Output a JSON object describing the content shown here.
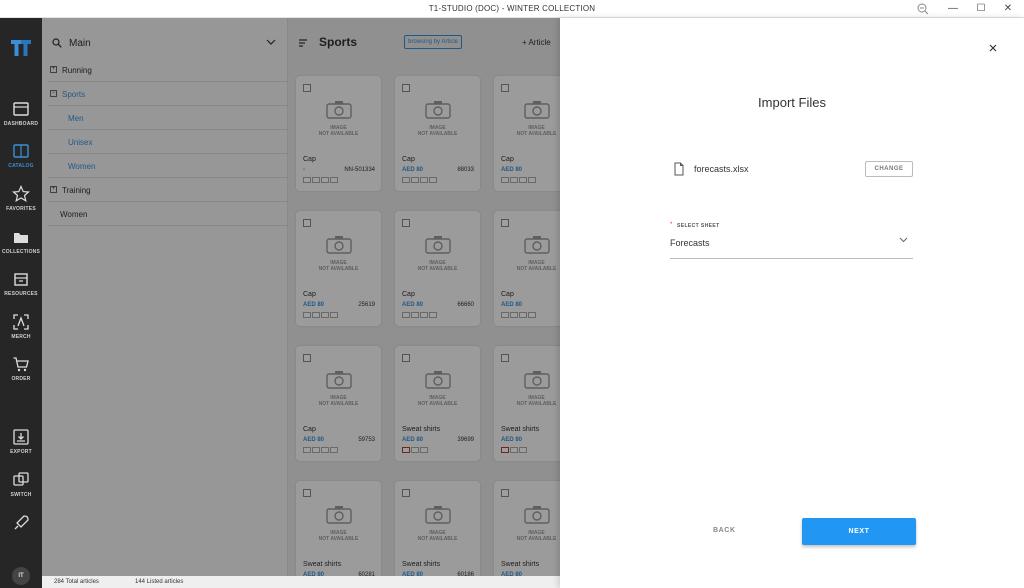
{
  "window": {
    "title": "T1-STUDIO (DOC) - WINTER COLLECTION",
    "zoom_icon": "zoom-out-icon",
    "minimize_glyph": "—",
    "maximize_glyph": "☐",
    "close_glyph": "✕"
  },
  "rail": {
    "items": [
      {
        "label": "DASHBOARD",
        "icon": "dashboard-icon"
      },
      {
        "label": "CATALOG",
        "icon": "catalog-icon",
        "active": true
      },
      {
        "label": "FAVORITES",
        "icon": "star-icon"
      },
      {
        "label": "COLLECTIONS",
        "icon": "folder-icon"
      },
      {
        "label": "RESOURCES",
        "icon": "resources-icon"
      },
      {
        "label": "MERCH",
        "icon": "merch-icon"
      },
      {
        "label": "ORDER",
        "icon": "cart-icon"
      },
      {
        "label": "EXPORT",
        "icon": "export-icon"
      },
      {
        "label": "SWITCH",
        "icon": "switch-icon"
      },
      {
        "label": "",
        "icon": "rocket-icon"
      }
    ],
    "avatar": "IT",
    "accent": "#3b8fd6"
  },
  "sidenav": {
    "title": "Main",
    "items": [
      {
        "label": "Running",
        "toggle": "+",
        "type": "parent"
      },
      {
        "label": "Sports",
        "toggle": "−",
        "type": "parent-open"
      },
      {
        "label": "Men",
        "type": "child"
      },
      {
        "label": "Unisex",
        "type": "child"
      },
      {
        "label": "Women",
        "type": "child"
      },
      {
        "label": "Training",
        "toggle": "+",
        "type": "parent"
      },
      {
        "label": "Women",
        "type": "plain"
      }
    ]
  },
  "content": {
    "heading": "Sports",
    "browse_badge": "browsing by Article",
    "add_label": "+ Article",
    "image_na_line1": "IMAGE",
    "image_na_line2": "NOT AVAILABLE",
    "cards": [
      {
        "name": "Cap",
        "price": "-",
        "code": "NN-501334",
        "sizes": [
          0,
          0,
          0,
          0
        ]
      },
      {
        "name": "Cap",
        "price": "AED 80",
        "code": "88033",
        "sizes": [
          0,
          0,
          0,
          0
        ]
      },
      {
        "name": "Cap",
        "price": "AED 80",
        "code": "16",
        "sizes": [
          0,
          0,
          0,
          0
        ]
      },
      {
        "name": "Cap",
        "price": "AED 80",
        "code": "25619",
        "sizes": [
          0,
          0,
          0,
          0
        ]
      },
      {
        "name": "Cap",
        "price": "AED 80",
        "code": "66660",
        "sizes": [
          0,
          0,
          0,
          0
        ]
      },
      {
        "name": "Cap",
        "price": "AED 80",
        "code": "43",
        "sizes": [
          0,
          0,
          0,
          0
        ]
      },
      {
        "name": "Cap",
        "price": "AED 80",
        "code": "59753",
        "sizes": [
          0,
          0,
          0,
          0
        ]
      },
      {
        "name": "Sweat shirts",
        "price": "AED 80",
        "code": "39699",
        "sizes": [
          1,
          0,
          0
        ]
      },
      {
        "name": "Sweat shirts",
        "price": "AED 80",
        "code": "95",
        "sizes": [
          1,
          0,
          0
        ]
      },
      {
        "name": "Sweat shirts",
        "price": "AED 80",
        "code": "60281",
        "sizes": [
          0,
          0,
          0
        ]
      },
      {
        "name": "Sweat shirts",
        "price": "AED 80",
        "code": "60186",
        "sizes": [
          0,
          0,
          0
        ]
      },
      {
        "name": "Sweat shirts",
        "price": "AED 80",
        "code": "51",
        "sizes": [
          0,
          0,
          0
        ]
      }
    ]
  },
  "statusbar": {
    "total": "284 Total articles",
    "listed": "144 Listed articles"
  },
  "dialog": {
    "title": "Import Files",
    "file_name": "forecasts.xlsx",
    "change_label": "CHANGE",
    "required_mark": "*",
    "sheet_label": "SELECT SHEET",
    "sheet_value": "Forecasts",
    "back_label": "BACK",
    "next_label": "NEXT",
    "primary_color": "#2196f3"
  }
}
